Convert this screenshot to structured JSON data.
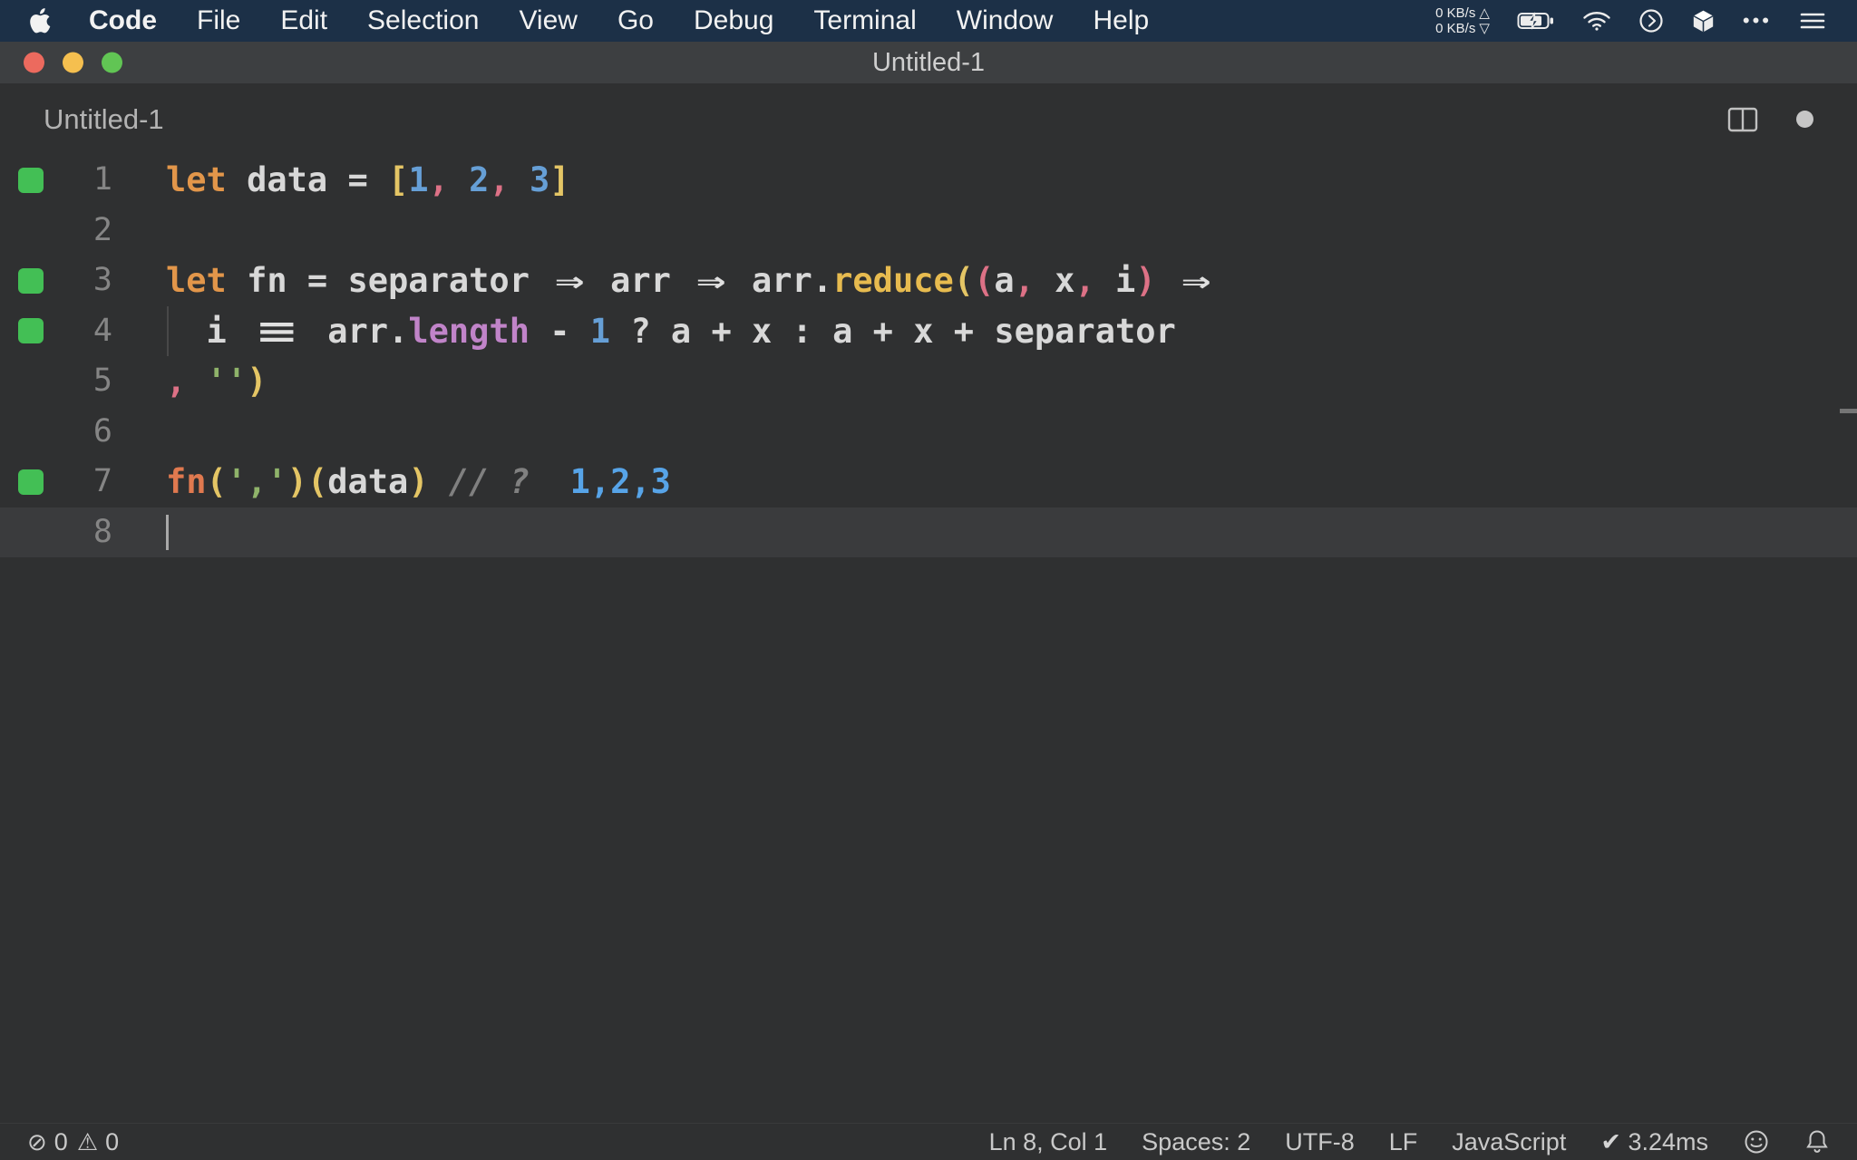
{
  "app": {
    "window_title": "Untitled-1"
  },
  "colors": {
    "menubar_bg": "#1c3047",
    "titlebar_bg": "#3d3f41",
    "editor_bg": "#2f3031",
    "statusbar_bg": "#2f3031",
    "current_line_bg": "#3a3b3d",
    "gutter_number": "#858585",
    "coverage_green": "#43bf55",
    "traffic_red": "#ec6a5e",
    "traffic_yellow": "#f5bf4f",
    "traffic_green": "#61c554",
    "token": {
      "kw": "#e2964a",
      "fg": "#d8d8d8",
      "num": "#669fd6",
      "pk": "#dd7186",
      "yl": "#e4c565",
      "fn": "#e7bb4f",
      "prop": "#c184c9",
      "str": "#8fb36a",
      "cm": "#808080",
      "res": "#57a4e8",
      "fncall": "#e0794f",
      "op": "#e0e0e0"
    }
  },
  "icons": {
    "error": "⊘",
    "warning": "⚠",
    "check": "✔",
    "net_up": "△",
    "net_down": "▽",
    "ellipsis": "•••"
  },
  "menu_bar": {
    "items": [
      {
        "label": "Code",
        "bold": true
      },
      {
        "label": "File"
      },
      {
        "label": "Edit"
      },
      {
        "label": "Selection"
      },
      {
        "label": "View"
      },
      {
        "label": "Go"
      },
      {
        "label": "Debug"
      },
      {
        "label": "Terminal"
      },
      {
        "label": "Window"
      },
      {
        "label": "Help"
      }
    ],
    "net_up": "0 KB/s",
    "net_down": "0 KB/s"
  },
  "editor_header": {
    "filename": "Untitled-1"
  },
  "editor": {
    "language": "JavaScript",
    "lines": [
      {
        "n": "1",
        "cov": true,
        "tokens": [
          [
            "kw",
            "let"
          ],
          [
            "fg",
            " data = "
          ],
          [
            "yl",
            "["
          ],
          [
            "num",
            "1"
          ],
          [
            "pk",
            ","
          ],
          [
            "num",
            " 2"
          ],
          [
            "pk",
            ","
          ],
          [
            "num",
            " 3"
          ],
          [
            "yl",
            "]"
          ]
        ]
      },
      {
        "n": "2",
        "tokens": []
      },
      {
        "n": "3",
        "cov": true,
        "tokens": [
          [
            "kw",
            "let"
          ],
          [
            "fg",
            " fn = separator "
          ],
          [
            "arw",
            "⇒"
          ],
          [
            "fg",
            " arr "
          ],
          [
            "arw",
            "⇒"
          ],
          [
            "fg",
            " arr."
          ],
          [
            "fn",
            "reduce"
          ],
          [
            "yl",
            "("
          ],
          [
            "pk",
            "("
          ],
          [
            "fg",
            "a"
          ],
          [
            "pk",
            ","
          ],
          [
            "fg",
            " x"
          ],
          [
            "pk",
            ","
          ],
          [
            "fg",
            " i"
          ],
          [
            "pk",
            ")"
          ],
          [
            "fg",
            " "
          ],
          [
            "arw",
            "⇒"
          ]
        ]
      },
      {
        "n": "4",
        "cov": true,
        "indent_guide": true,
        "tokens": [
          [
            "fg",
            "  i "
          ],
          [
            "eq3",
            "≡"
          ],
          [
            "fg",
            " arr."
          ],
          [
            "prop",
            "length"
          ],
          [
            "fg",
            " - "
          ],
          [
            "num",
            "1"
          ],
          [
            "fg",
            " ? a + x : a + x + separator"
          ]
        ]
      },
      {
        "n": "5",
        "tokens": [
          [
            "pk",
            ", "
          ],
          [
            "str",
            "''"
          ],
          [
            "yl",
            ")"
          ]
        ]
      },
      {
        "n": "6",
        "tokens": []
      },
      {
        "n": "7",
        "cov": true,
        "tokens": [
          [
            "fncall",
            "fn"
          ],
          [
            "yl",
            "("
          ],
          [
            "str",
            "','"
          ],
          [
            "yl",
            ")"
          ],
          [
            "yl",
            "("
          ],
          [
            "fg",
            "data"
          ],
          [
            "yl",
            ")"
          ],
          [
            "cm",
            " // ?"
          ],
          [
            "res",
            "  1,2,3"
          ]
        ]
      },
      {
        "n": "8",
        "current": true,
        "cursor": true,
        "tokens": []
      }
    ]
  },
  "status_bar": {
    "errors": "0",
    "warnings": "0",
    "right_items": [
      {
        "name": "cursor-position",
        "label": "Ln 8, Col 1"
      },
      {
        "name": "indentation",
        "label": "Spaces: 2"
      },
      {
        "name": "encoding",
        "label": "UTF-8"
      },
      {
        "name": "eol",
        "label": "LF"
      },
      {
        "name": "language-mode",
        "label": "JavaScript"
      },
      {
        "name": "quokka-perf",
        "label": "3.24ms",
        "icon": "check"
      }
    ]
  }
}
